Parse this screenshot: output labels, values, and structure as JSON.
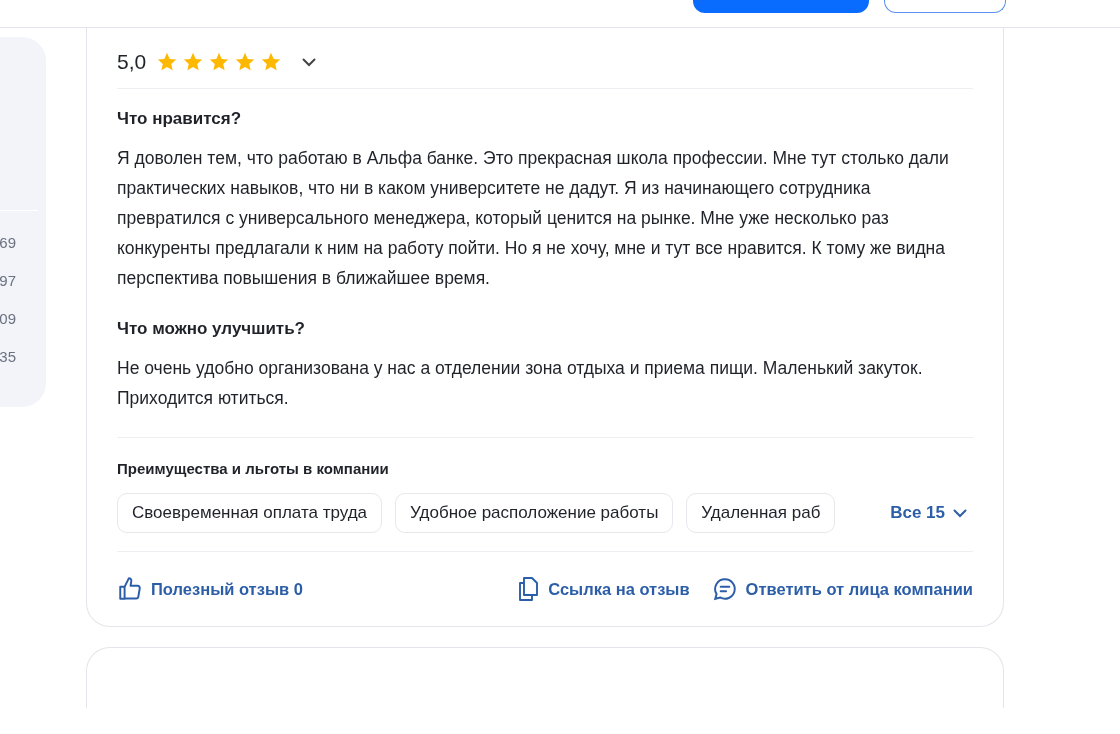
{
  "sidebar": {
    "values": [
      "69",
      "97",
      "09",
      "35"
    ]
  },
  "review": {
    "score": "5,0",
    "stars": 5,
    "expanded": false,
    "sections": [
      {
        "title": "Что нравится?",
        "text": "Я доволен тем, что работаю в Альфа банке. Это прекрасная школа профессии. Мне тут столько дали практических навыков, что ни в каком университете не дадут. Я из начинающего сотрудника превратился с универсального менеджера, который ценится на рынке. Мне уже несколько раз конкуренты предлагали к ним на работу пойти. Но я не хочу, мне и тут все нравится. К тому же видна перспектива повышения в ближайшее время."
      },
      {
        "title": "Что можно улучшить?",
        "text": "Не очень удобно организована у нас а отделении зона отдыха и приема пищи. Маленький закуток. Приходится ютиться."
      }
    ],
    "benefits": {
      "title": "Преимущества и льготы в компании",
      "tags": [
        "Своевременная оплата труда",
        "Удобное расположение работы",
        "Удаленная раб"
      ],
      "more": "Все 15"
    },
    "actions": [
      {
        "kind": "like",
        "label": "Полезный отзыв 0"
      },
      {
        "kind": "link",
        "label": "Ссылка на отзыв"
      },
      {
        "kind": "reply",
        "label": "Ответить от лица компании"
      }
    ]
  }
}
